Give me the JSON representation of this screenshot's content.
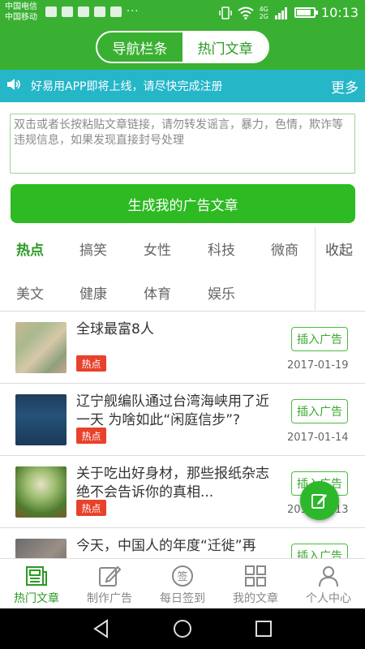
{
  "status_bar": {
    "carrier1": "中国电信",
    "carrier2": "中国移动",
    "more_dots": "···",
    "network1": "4G",
    "network2": "2G",
    "time": "10:13"
  },
  "header": {
    "tabs": [
      {
        "label": "导航栏条",
        "active": false
      },
      {
        "label": "热门文章",
        "active": true
      }
    ]
  },
  "notice": {
    "icon": "speaker-icon",
    "text": "好易用APP即将上线，请尽快完成注册",
    "more": "更多"
  },
  "link_input": {
    "placeholder": "双击或者长按粘贴文章链接，请勿转发谣言，暴力，色情，欺诈等违规信息，如果发现直接封号处理",
    "value": ""
  },
  "generate_button": "生成我的广告文章",
  "categories": {
    "row1": [
      "热点",
      "搞笑",
      "女性",
      "科技",
      "微商"
    ],
    "row2": [
      "美文",
      "健康",
      "体育",
      "娱乐"
    ],
    "active": "热点",
    "collapse": "收起"
  },
  "news": [
    {
      "title": "全球最富8人",
      "badge": "热点",
      "action": "插入广告",
      "date": "2017-01-19"
    },
    {
      "title": "辽宁舰编队通过台湾海峡用了近一天 为啥如此“闲庭信步”?",
      "badge": "热点",
      "action": "插入广告",
      "date": "2017-01-14"
    },
    {
      "title": "关于吃出好身材，那些报纸杂志绝不会告诉你的真相...",
      "badge": "热点",
      "action": "插入广告",
      "date": "2017-01-13"
    },
    {
      "title": "今天，中国人的年度“迁徙”再",
      "badge": "",
      "action": "插入广告",
      "date": ""
    }
  ],
  "tabbar": [
    {
      "label": "热门文章",
      "icon": "newspaper-icon",
      "active": true
    },
    {
      "label": "制作广告",
      "icon": "edit-icon",
      "active": false
    },
    {
      "label": "每日签到",
      "icon": "sign-in-icon",
      "active": false,
      "icon_text": "签"
    },
    {
      "label": "我的文章",
      "icon": "grid-icon",
      "active": false
    },
    {
      "label": "个人中心",
      "icon": "user-icon",
      "active": false
    }
  ],
  "colors": {
    "primary": "#3ab033",
    "accent_green": "#2db82b",
    "notice_bg": "#25b6c8",
    "hot_badge": "#e8412c"
  }
}
